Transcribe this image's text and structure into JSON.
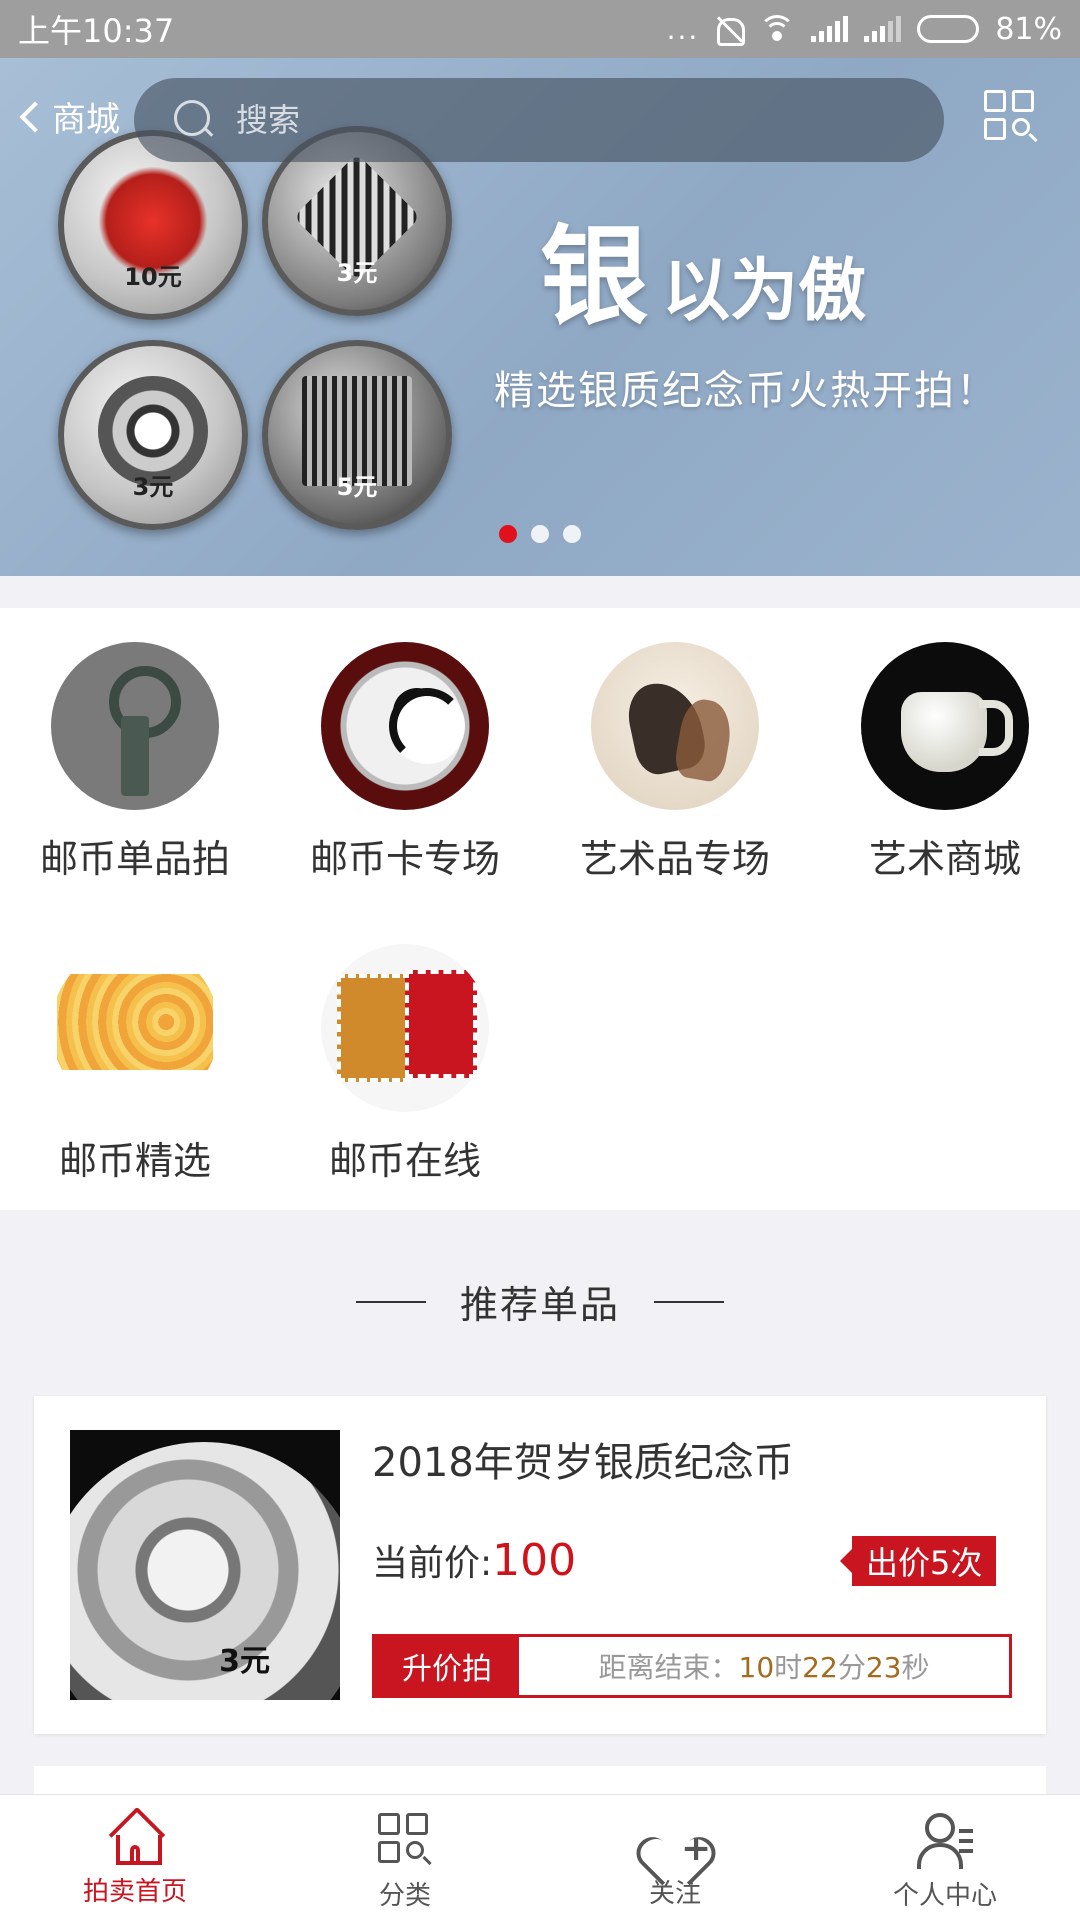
{
  "status_bar": {
    "time": "上午10:37",
    "dots": "...",
    "battery": "81%"
  },
  "header": {
    "back_label": "商城",
    "search_placeholder": "搜索"
  },
  "banner": {
    "title_big": "银",
    "title_rest": "以为傲",
    "subtitle": "精选银质纪念币火热开拍！",
    "coins": [
      {
        "denom": "10元"
      },
      {
        "denom": "3元"
      },
      {
        "denom": "3元"
      },
      {
        "denom": "5元"
      }
    ],
    "slide_count": 3,
    "active_slide": 1
  },
  "categories": [
    {
      "label": "邮币单品拍",
      "icon": "ancient-coin-sword"
    },
    {
      "label": "邮币卡专场",
      "icon": "panda-silver-coin"
    },
    {
      "label": "艺术品专场",
      "icon": "horse-painting"
    },
    {
      "label": "艺术商城",
      "icon": "jade-cup"
    },
    {
      "label": "邮币精选",
      "icon": "banknote"
    },
    {
      "label": "邮币在线",
      "icon": "stamp-logo"
    }
  ],
  "section": {
    "title": "推荐单品"
  },
  "product": {
    "name": "2018年贺岁银质纪念币",
    "price_label": "当前价:",
    "price": "100",
    "bid_count": "出价5次",
    "auction_type": "升价拍",
    "countdown_label": "距离结束：",
    "hours": "10",
    "hours_unit": "时",
    "minutes": "22",
    "minutes_unit": "分",
    "seconds": "23",
    "seconds_unit": "秒",
    "image_denom": "3元"
  },
  "bottom_nav": [
    {
      "label": "拍卖首页",
      "icon": "home-icon",
      "active": true
    },
    {
      "label": "分类",
      "icon": "category-icon",
      "active": false
    },
    {
      "label": "关注",
      "icon": "heart-plus-icon",
      "active": false
    },
    {
      "label": "个人中心",
      "icon": "user-list-icon",
      "active": false
    }
  ],
  "colors": {
    "accent": "#c8151f",
    "price": "#d0121b",
    "countdown_num": "#a46b1e",
    "page_bg": "#f2f2f6"
  }
}
